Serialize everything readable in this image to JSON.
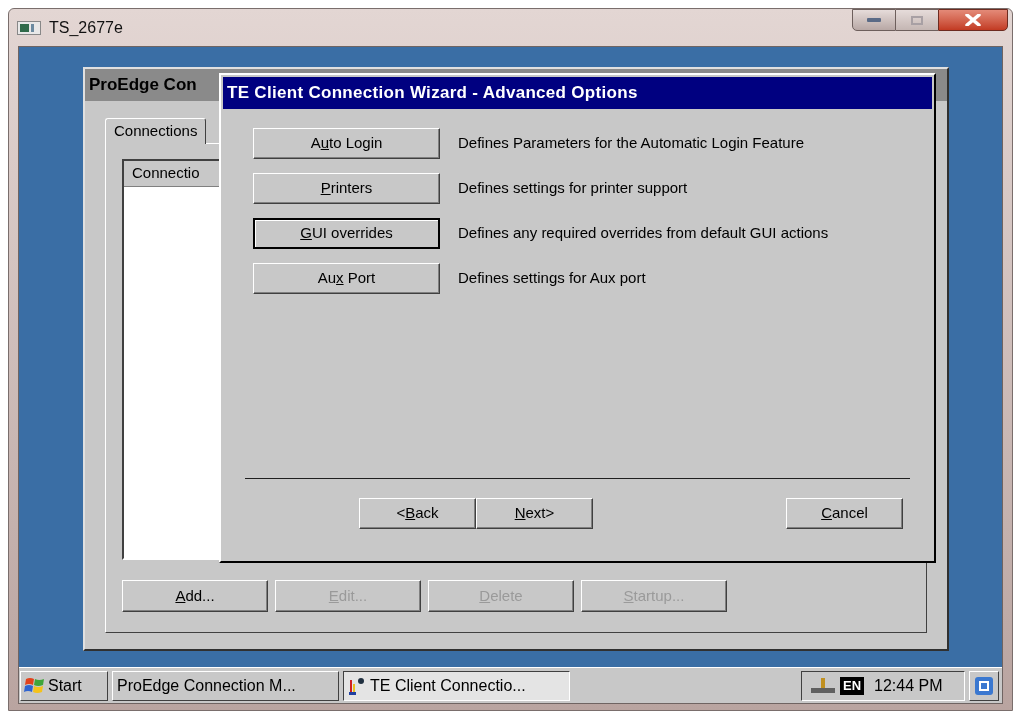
{
  "window": {
    "title": "TS_2677e"
  },
  "proedge_window": {
    "title": "ProEdge Con",
    "tabs": [
      {
        "label": "Connections",
        "selected": true
      }
    ],
    "list": {
      "column_header": "Connectio"
    },
    "buttons": [
      {
        "access_key": "A",
        "label_after": "dd...",
        "disabled": false
      },
      {
        "access_key": "E",
        "label_after": "dit...",
        "disabled": true
      },
      {
        "access_key": "D",
        "label_after": "elete",
        "disabled": true
      },
      {
        "access_key": "S",
        "label_after": "tartup...",
        "disabled": true
      }
    ]
  },
  "wizard": {
    "title": "TE Client Connection Wizard - Advanced Options",
    "options": [
      {
        "label_before": "A",
        "access_key": "u",
        "label_after": "to Login",
        "focused": false,
        "description": "Defines Parameters for the Automatic Login Feature"
      },
      {
        "access_key": "P",
        "label_after": "rinters",
        "focused": false,
        "description": "Defines settings for printer support"
      },
      {
        "access_key": "G",
        "label_after": "UI overrides",
        "focused": true,
        "description": "Defines any required overrides from default GUI actions"
      },
      {
        "label_before": "Au",
        "access_key": "x",
        "label_after": " Port",
        "focused": false,
        "description": "Defines settings for Aux port"
      }
    ],
    "nav_buttons": [
      {
        "label_before": "<",
        "access_key": "B",
        "label_after": "ack"
      },
      {
        "access_key": "N",
        "label_after": "ext>"
      }
    ],
    "cancel_button": {
      "access_key": "C",
      "label_after": "ancel"
    }
  },
  "taskbar": {
    "start": "Start",
    "tasks": [
      {
        "label": "ProEdge Connection M...",
        "selected": false
      },
      {
        "label": "TE Client Connectio...",
        "selected": true
      }
    ],
    "language": "EN",
    "clock": "12:44 PM"
  }
}
